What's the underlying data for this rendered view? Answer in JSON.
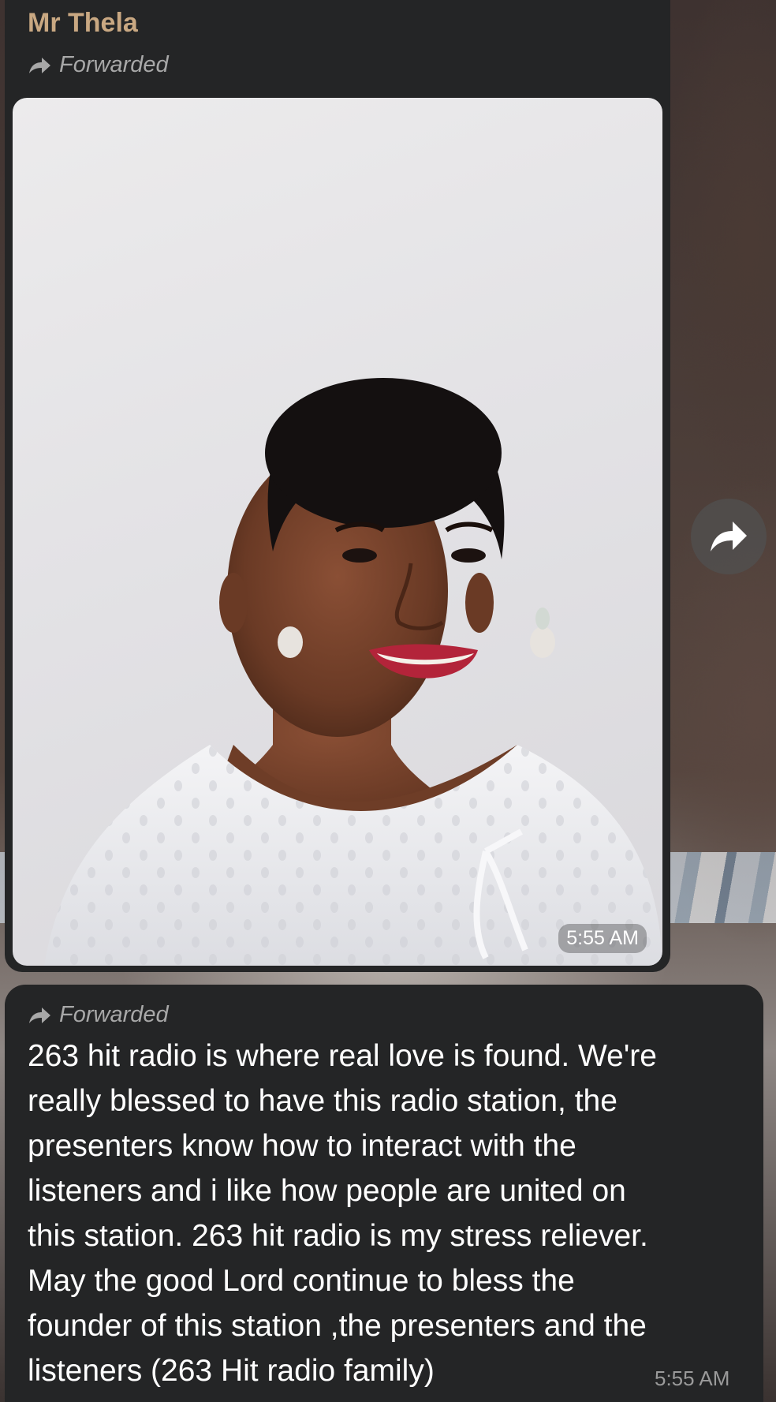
{
  "messages": [
    {
      "sender": "Mr Thela",
      "forwarded_label": "Forwarded",
      "type": "photo",
      "time": "5:55 AM"
    },
    {
      "forwarded_label": "Forwarded",
      "type": "text",
      "text": "263 hit radio is where real love is found. We're\nreally blessed to have this radio station, the\npresenters know how to interact with the\nlisteners and i like how people are united on\nthis station. 263 hit radio is my stress reliever.\nMay the good Lord continue to bless the\nfounder of this station ,the presenters and the\nlisteners (263 Hit radio family)",
      "time": "5:55 AM"
    }
  ],
  "icons": {
    "forward": "forward-arrow-icon",
    "share": "share-arrow-icon"
  },
  "colors": {
    "bubble_bg": "#242526",
    "sender_name": "#c9a882",
    "forwarded_text": "#a8a8a8",
    "message_text": "#ffffff"
  }
}
